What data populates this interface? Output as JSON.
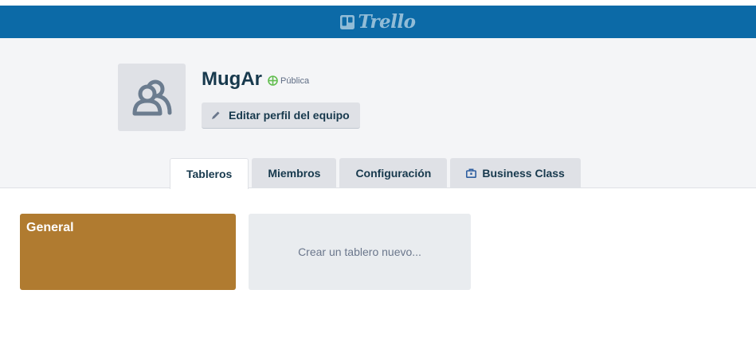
{
  "header": {
    "logo_text": "Trello",
    "color": "#0c6aa7"
  },
  "team": {
    "name": "MugAr",
    "visibility_label": "Pública",
    "visibility_color": "#61bd4f",
    "edit_button_label": "Editar perfil del equipo",
    "avatar_icon": "team-icon"
  },
  "tabs": [
    {
      "label": "Tableros",
      "active": true
    },
    {
      "label": "Miembros",
      "active": false
    },
    {
      "label": "Configuración",
      "active": false
    },
    {
      "label": "Business Class",
      "active": false,
      "icon": "briefcase-icon"
    }
  ],
  "boards": [
    {
      "title": "General",
      "color": "#b07b30"
    }
  ],
  "new_board_label": "Crear un tablero nuevo..."
}
